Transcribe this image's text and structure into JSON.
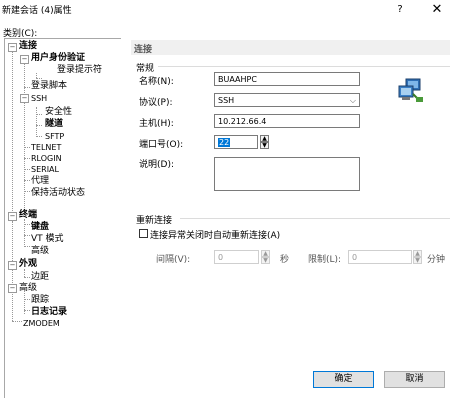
{
  "window": {
    "title": "新建会话 (4)属性",
    "help_glyph": "?",
    "close_glyph": "✕"
  },
  "category_label": "类别(C):",
  "tree": {
    "connection": "连接",
    "auth": "用户身份验证",
    "login_prompt": "登录提示符",
    "login_script": "登录脚本",
    "ssh": "SSH",
    "security": "安全性",
    "tunnel": "隧道",
    "sftp": "SFTP",
    "telnet": "TELNET",
    "rlogin": "RLOGIN",
    "serial": "SERIAL",
    "proxy": "代理",
    "keepalive": "保持活动状态",
    "terminal": "终端",
    "keyboard": "键盘",
    "vt_mode": "VT 模式",
    "advanced_term": "高级",
    "appearance": "外观",
    "margin": "边距",
    "advanced": "高级",
    "trace": "跟踪",
    "logging": "日志记录",
    "zmodem": "ZMODEM"
  },
  "panel": {
    "header": "连接",
    "general_group": "常规",
    "name_label": "名称(N):",
    "name_value": "BUAAHPC",
    "protocol_label": "协议(P):",
    "protocol_value": "SSH",
    "host_label": "主机(H):",
    "host_value": "10.212.66.4",
    "port_label": "端口号(O):",
    "port_value": "22",
    "desc_label": "说明(D):",
    "desc_value": "",
    "reconnect_group": "重新连接",
    "reconnect_checkbox": "连接异常关闭时自动重新连接(A)",
    "interval_label": "间隔(V):",
    "interval_value": "0",
    "seconds_unit": "秒",
    "limit_label": "限制(L):",
    "limit_value": "0",
    "minutes_unit": "分钟"
  },
  "buttons": {
    "ok": "确定",
    "cancel": "取消"
  },
  "colors": {
    "selected_port_bg": "#0078d7",
    "border": "#7a7a7a"
  }
}
